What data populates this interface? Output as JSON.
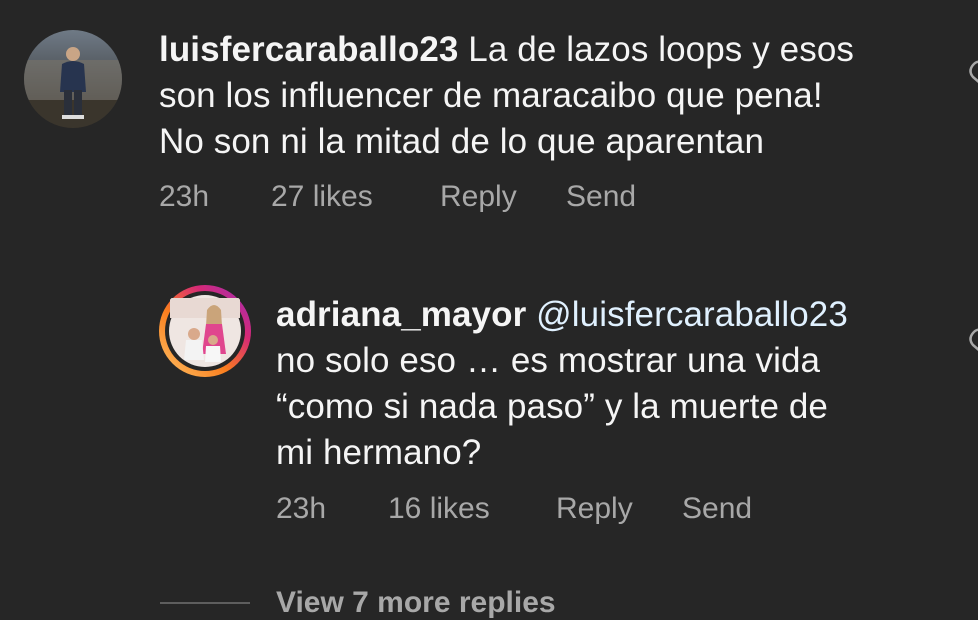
{
  "comments": [
    {
      "username": "luisfercaraballo23",
      "text_lines": [
        "La de lazos loops y esos",
        "son los influencer de maracaibo que pena!",
        "No son ni la mitad de lo que aparentan"
      ],
      "time": "23h",
      "likes": "27 likes",
      "reply_label": "Reply",
      "send_label": "Send",
      "avatar_icon": "person-photo-avatar"
    },
    {
      "username": "adriana_mayor",
      "mention": "@luisfercaraballo23",
      "text_lines": [
        "no solo eso … es mostrar una vida",
        "“como si nada paso” y la muerte de",
        "mi hermano?"
      ],
      "time": "23h",
      "likes": "16 likes",
      "reply_label": "Reply",
      "send_label": "Send",
      "avatar_icon": "story-ring-avatar"
    }
  ],
  "view_more_label": "View 7 more replies",
  "colors": {
    "background": "#262626",
    "primary_text": "#f5f5f5",
    "secondary_text": "#a8a8a8",
    "mention": "#e0f1ff"
  }
}
